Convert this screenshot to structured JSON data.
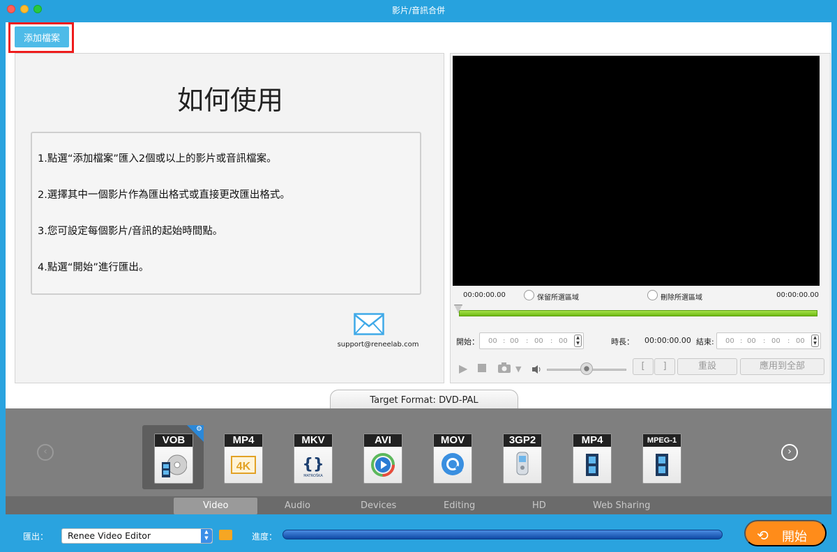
{
  "window": {
    "title": "影片/音訊合併"
  },
  "toolbar": {
    "add_file_label": "添加檔案"
  },
  "howto": {
    "title": "如何使用",
    "steps": [
      "1.點選“添加檔案”匯入2個或以上的影片或音訊檔案。",
      "2.選擇其中一個影片作為匯出格式或直接更改匯出格式。",
      "3.您可設定每個影片/音訊的起始時間點。",
      "4.點選“開始”進行匯出。"
    ],
    "support_email": "support@reneelab.com"
  },
  "player": {
    "time_start": "00:00:00.00",
    "time_end": "00:00:00.00",
    "keep_selected_label": "保留所選區域",
    "delete_selected_label": "刪除所選區域",
    "start_label": "開始：",
    "duration_label": "時長：",
    "duration_value": "00:00:00.00",
    "end_label": "結束:",
    "time_fields": [
      "00",
      "00",
      "00",
      "00"
    ],
    "bracket_open": "[",
    "bracket_close": "]",
    "reset_label": "重設",
    "apply_all_label": "應用到全部"
  },
  "target_format": {
    "label": "Target Format: DVD-PAL"
  },
  "formats": [
    {
      "name": "VOB",
      "selected": true,
      "icon": "dvd-disc-icon"
    },
    {
      "name": "MP4",
      "selected": false,
      "icon": "4k-icon"
    },
    {
      "name": "MKV",
      "selected": false,
      "icon": "matroska-icon",
      "sub": "MATROŠKA"
    },
    {
      "name": "AVI",
      "selected": false,
      "icon": "media-player-icon"
    },
    {
      "name": "MOV",
      "selected": false,
      "icon": "quicktime-icon"
    },
    {
      "name": "3GP2",
      "selected": false,
      "icon": "phone-icon"
    },
    {
      "name": "MP4",
      "selected": false,
      "icon": "film-icon"
    },
    {
      "name": "MPEG-1",
      "selected": false,
      "icon": "film-icon"
    }
  ],
  "categories": [
    {
      "label": "Video",
      "active": true
    },
    {
      "label": "Audio",
      "active": false
    },
    {
      "label": "Devices",
      "active": false
    },
    {
      "label": "Editing",
      "active": false
    },
    {
      "label": "HD",
      "active": false
    },
    {
      "label": "Web Sharing",
      "active": false
    }
  ],
  "bottom": {
    "export_label": "匯出：",
    "export_value": "Renee Video Editor",
    "progress_label": "進度：",
    "progress_value": 0,
    "start_button_label": "開始"
  },
  "colors": {
    "accent": "#2aa3df",
    "start_button": "#ff8c1a",
    "timeline": "#8bd12e"
  }
}
